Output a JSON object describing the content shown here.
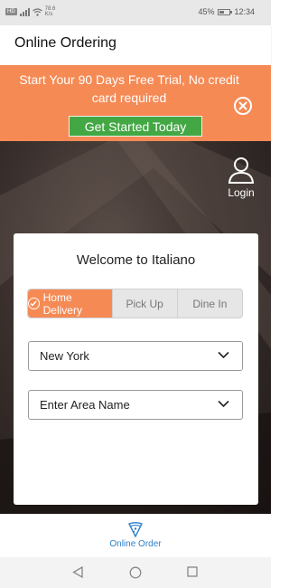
{
  "status_bar": {
    "left_tag": "HD",
    "speed_value": "78.6",
    "speed_unit": "K/s",
    "battery": "45%",
    "time": "12:34"
  },
  "header": {
    "title": "Online Ordering"
  },
  "banner": {
    "text": "Start Your 90 Days Free Trial, No credit card required",
    "cta_label": "Get Started Today",
    "close_icon": "close-circle-icon",
    "color": "#f58a55",
    "cta_color": "#43a844"
  },
  "login": {
    "label": "Login",
    "icon": "user-icon"
  },
  "card": {
    "welcome": "Welcome to Italiano",
    "tabs": [
      {
        "label": "Home Delivery",
        "active": true
      },
      {
        "label": "Pick Up",
        "active": false
      },
      {
        "label": "Dine In",
        "active": false
      }
    ],
    "city_select": {
      "value": "New York"
    },
    "area_select": {
      "value": "Enter Area Name"
    }
  },
  "bottom_nav": {
    "items": [
      {
        "label": "Online Order",
        "icon": "pizza-slice-icon",
        "active": true
      }
    ],
    "accent": "#2f80c9"
  },
  "system_nav": {
    "back": "back-icon",
    "home": "home-icon",
    "recents": "recents-icon"
  }
}
